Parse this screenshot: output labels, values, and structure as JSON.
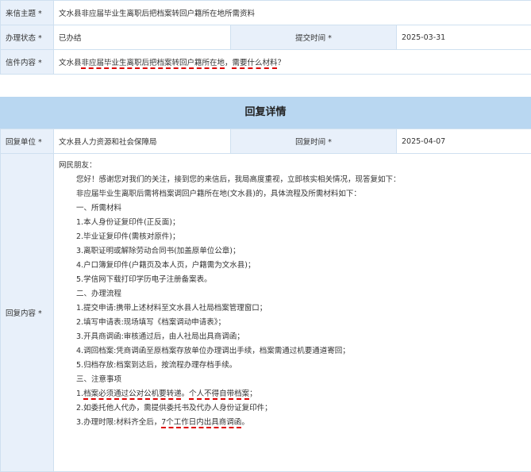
{
  "top": {
    "subject_label": "来信主题 *",
    "subject_value": "文水县非应届毕业生离职后把档案转回户籍所在地所需资料",
    "status_label": "办理状态 *",
    "status_value": "已办结",
    "submit_time_label": "提交时间 *",
    "submit_time_value": "2025-03-31",
    "content_label": "信件内容 *",
    "content_pre": "文水县",
    "content_ul1": "非应届毕业生离职后把档案转回户籍所在地",
    "content_mid": "，",
    "content_ul2": "需要什么材料",
    "content_post": "？"
  },
  "reply": {
    "section_title": "回复详情",
    "unit_label": "回复单位 *",
    "unit_value": "文水县人力资源和社会保障局",
    "time_label": "回复时间 *",
    "time_value": "2025-04-07",
    "content_label": "回复内容 *",
    "lines": {
      "greet": "网民朋友：",
      "l1": "您好！感谢您对我们的关注，接到您的来信后，我局高度重视，立即核实相关情况，现答复如下：",
      "l2": "非应届毕业生离职后需将档案调回户籍所在地(文水县)的，具体流程及所需材料如下：",
      "s1": "一、所需材料",
      "m1": "1.本人身份证复印件(正反面)；",
      "m2": "2.毕业证复印件(需核对原件)；",
      "m3": "3.离职证明或解除劳动合同书(加盖原单位公章)；",
      "m4": "4.户口簿复印件(户籍页及本人页，户籍需为文水县)；",
      "m5": "5.学信网下载打印学历电子注册备案表。",
      "s2": "二、办理流程",
      "p1": "1.提交申请:携带上述材料至文水县人社局档案管理窗口；",
      "p2": "2.填写申请表:现场填写《档案调动申请表》；",
      "p3": "3.开具商调函:审核通过后，由人社局出具商调函；",
      "p4": "4.调回档案:凭商调函至原档案存放单位办理调出手续，档案需通过机要通道寄回；",
      "p5": "5.归档存放:档案到达后，按流程办理存档手续。",
      "s3": "三、注意事项",
      "n1_ul1": "档案必须通过公对公机要转递",
      "n1_pre": "1.",
      "n1_mid": "。",
      "n1_ul2": "个人不得自带档案",
      "n1_post": "；",
      "n2": "2.如委托他人代办，需提供委托书及代办人身份证复印件；",
      "n3_pre": "3.办理时限:材料齐全后，",
      "n3_ul": "7个工作日内出具商调函",
      "n3_post": "。"
    }
  }
}
